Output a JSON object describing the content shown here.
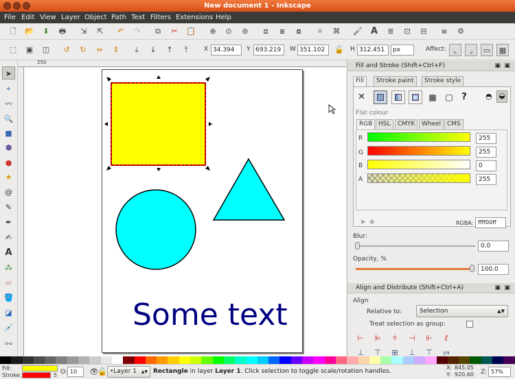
{
  "window": {
    "title": "New document 1 - Inkscape"
  },
  "menu": [
    "File",
    "Edit",
    "View",
    "Layer",
    "Object",
    "Path",
    "Text",
    "Filters",
    "Extensions",
    "Help"
  ],
  "toolbar2": {
    "x_label": "X",
    "x_value": "34.394",
    "y_label": "Y",
    "y_value": "693.219",
    "w_label": "W",
    "w_value": "351.102",
    "h_label": "H",
    "h_value": "312.451",
    "unit": "px",
    "affect_label": "Affect:"
  },
  "ruler": {
    "mark_250": "250"
  },
  "canvas": {
    "text": "Some text",
    "colors": {
      "rect_fill": "#ffff00",
      "rect_stroke": "#ff0000",
      "shape_fill": "#00ffff",
      "text_fill": "#000080"
    }
  },
  "fill_stroke": {
    "title": "Fill and Stroke (Shift+Ctrl+F)",
    "tabs": [
      "Fill",
      "Stroke paint",
      "Stroke style"
    ],
    "flat_colour_label": "Flat colour",
    "color_tabs": [
      "RGB",
      "HSL",
      "CMYK",
      "Wheel",
      "CMS"
    ],
    "channels": [
      {
        "label": "R",
        "value": "255"
      },
      {
        "label": "G",
        "value": "255"
      },
      {
        "label": "B",
        "value": "0"
      },
      {
        "label": "A",
        "value": "255"
      }
    ],
    "rgba_label": "RGBA:",
    "rgba_value": "ffff00ff",
    "blur_label": "Blur:",
    "blur_value": "0.0",
    "opacity_label": "Opacity, %",
    "opacity_value": "100.0",
    "unset_glyph": "?",
    "none_glyph": "✕"
  },
  "align": {
    "title": "Align and Distribute (Shift+Ctrl+A)",
    "section": "Align",
    "relative_label": "Relative to:",
    "relative_value": "Selection",
    "group_label": "Treat selection as group:"
  },
  "status": {
    "fill_label": "Fill:",
    "stroke_label": "Stroke:",
    "stroke_width": "5",
    "opacity_label": "O:",
    "opacity_value": "10",
    "layer": "•Layer 1",
    "message_prefix": "Rectangle",
    "message_mid": " in layer ",
    "message_layer": "Layer 1",
    "message_suffix": ". Click selection to toggle scale/rotation handles.",
    "x_label": "X:",
    "x_value": "845.05",
    "y_label": "Y:",
    "y_value": "920.60",
    "z_label": "Z:",
    "zoom": "57%"
  }
}
